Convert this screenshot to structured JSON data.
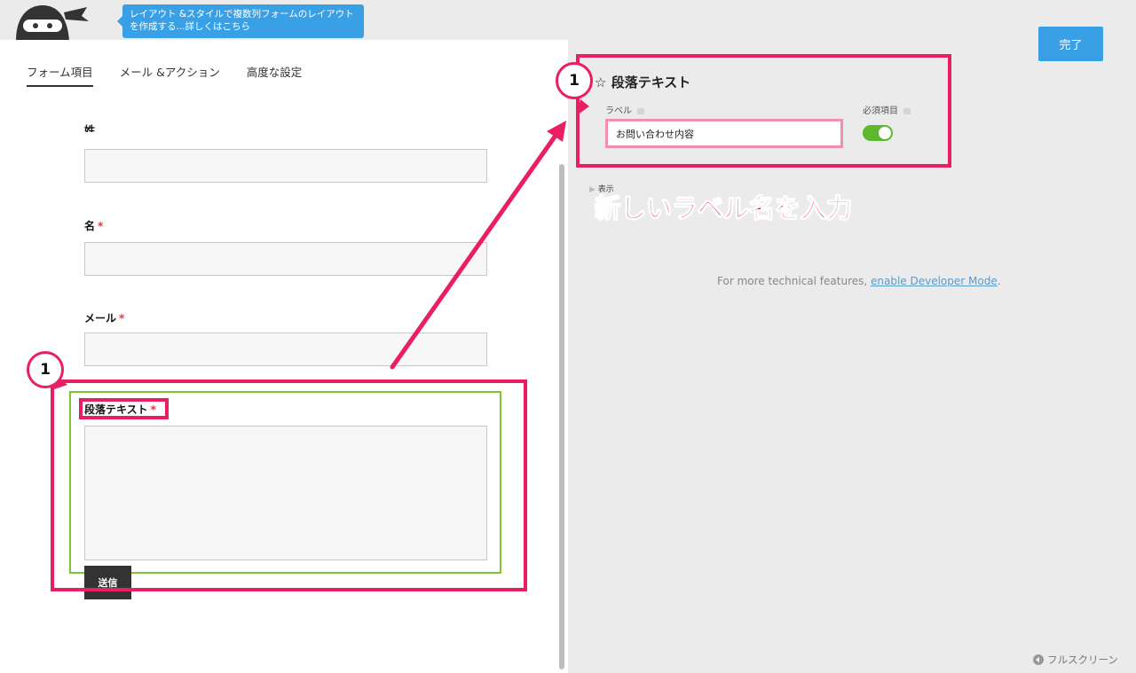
{
  "header": {
    "tooltip": "レイアウト &スタイルで複数列フォームのレイアウトを作成する...詳しくはこちら"
  },
  "tabs": [
    {
      "label": "フォーム項目",
      "active": true
    },
    {
      "label": "メール &アクション",
      "active": false
    },
    {
      "label": "高度な設定",
      "active": false
    }
  ],
  "form": {
    "partial_label": "姓",
    "first_name_label": "名",
    "email_label": "メール",
    "paragraph_label": "段落テキスト",
    "required_mark": "*",
    "submit_label": "送信"
  },
  "panel": {
    "done_label": "完了",
    "title": "段落テキスト",
    "title_icon": "☆",
    "label_caption": "ラベル",
    "label_value": "お問い合わせ内容",
    "required_caption": "必須項目",
    "required_on": true,
    "display_label": "表示",
    "dev_text": "For more technical features, ",
    "dev_link": "enable Developer Mode",
    "dev_end": ".",
    "fullscreen_label": "フルスクリーン"
  },
  "annotation": {
    "step": "1",
    "caption": "新しいラベル名を入力",
    "accent_color": "#ea1f61",
    "field_highlight_color": "#7dc832"
  }
}
